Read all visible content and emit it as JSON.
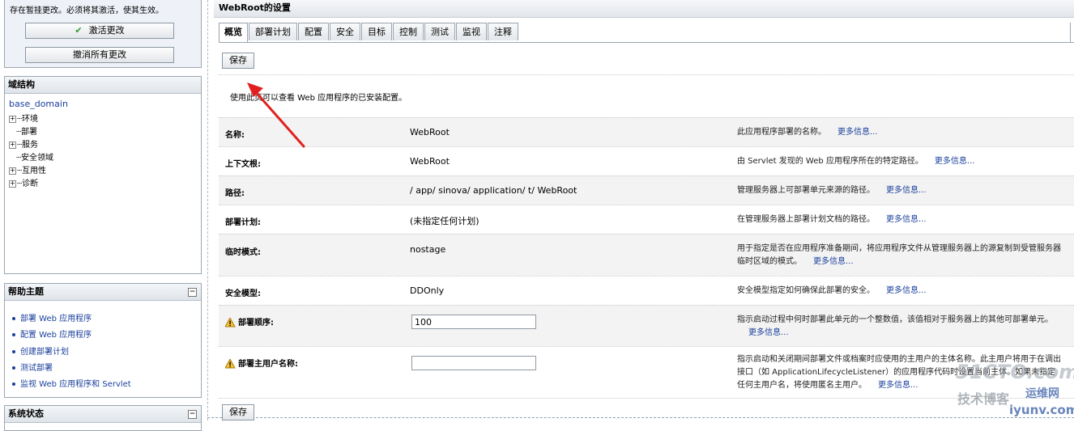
{
  "change_center": {
    "message": "存在暂挂更改。必须将其激活，使其生效。",
    "activate_label": "激活更改",
    "undo_label": "撤消所有更改"
  },
  "domain_structure": {
    "title": "域结构",
    "root": "base_domain",
    "items": [
      {
        "label": "环境",
        "expandable": true
      },
      {
        "label": "部署",
        "expandable": false
      },
      {
        "label": "服务",
        "expandable": true
      },
      {
        "label": "安全领域",
        "expandable": false
      },
      {
        "label": "互用性",
        "expandable": true
      },
      {
        "label": "诊断",
        "expandable": true
      }
    ]
  },
  "help": {
    "title": "帮助主题",
    "collapse": "−",
    "links": [
      "部署 Web 应用程序",
      "配置 Web 应用程序",
      "创建部署计划",
      "测试部署",
      "监视 Web 应用程序和 Servlet"
    ]
  },
  "system_status": {
    "title": "系统状态",
    "collapse": "−"
  },
  "main": {
    "title": "WebRoot的设置",
    "tabs": [
      "概览",
      "部署计划",
      "配置",
      "安全",
      "目标",
      "控制",
      "测试",
      "监视",
      "注释"
    ],
    "active_tab": 0,
    "save_label": "保存",
    "intro": "使用此页可以查看 Web 应用程序的已安装配置。",
    "more_info": "更多信息...",
    "rows": [
      {
        "label": "名称:",
        "value": "WebRoot",
        "desc": "此应用程序部署的名称。"
      },
      {
        "label": "上下文根:",
        "value": "WebRoot",
        "desc": "由 Servlet 发现的 Web 应用程序所在的特定路径。"
      },
      {
        "label": "路径:",
        "value": "/ app/ sinova/ application/ t/ WebRoot",
        "desc": "管理服务器上可部署单元来源的路径。"
      },
      {
        "label": "部署计划:",
        "value": "(未指定任何计划)",
        "desc": "在管理服务器上部署计划文档的路径。"
      },
      {
        "label": "临时模式:",
        "value": "nostage",
        "desc": "用于指定是否在应用程序准备期间，将应用程序文件从管理服务器上的源复制到受管服务器临时区域的模式。"
      },
      {
        "label": "安全模型:",
        "value": "DDOnly",
        "desc": "安全模型指定如何确保此部署的安全。"
      },
      {
        "label": "部署顺序:",
        "value": "100",
        "desc": "指示启动过程中何时部署此单元的一个整数值，该值相对于服务器上的其他可部署单元。"
      },
      {
        "label": "部署主用户名称:",
        "value": "",
        "desc": "指示启动和关闭期间部署文件或档案时应使用的主用户的主体名称。此主用户将用于在调出接口（如 ApplicationLifecycleListener）的应用程序代码时设置当前主体。如果未指定任何主用户名，将使用匿名主用户。"
      }
    ]
  },
  "watermark": {
    "line1": "51CTO.com",
    "line2": "技术博客",
    "line3": "运维网",
    "line4": "iyunv.com"
  },
  "colors": {
    "link": "#1a3f9c",
    "arrow": "#e02020",
    "activate_check": "#2a9a2a"
  }
}
